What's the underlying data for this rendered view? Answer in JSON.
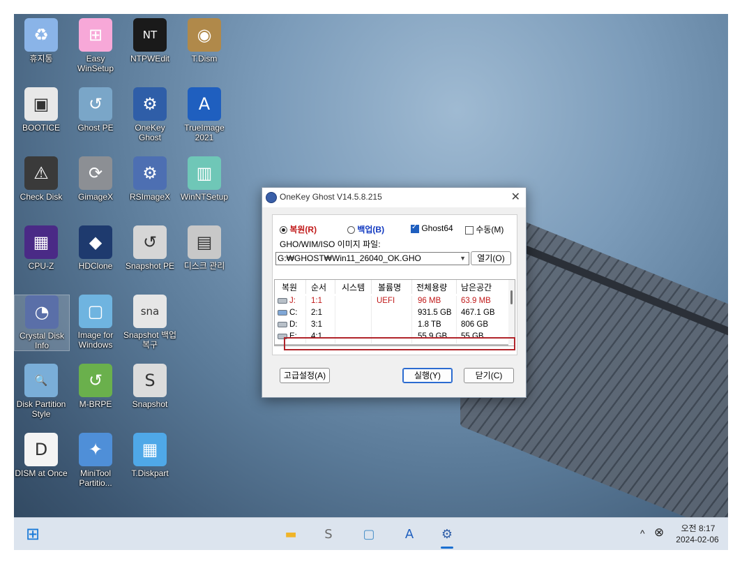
{
  "desktop": {
    "icons": [
      {
        "label": "휴지통",
        "glyph": "♻",
        "color": "#8ab4e8"
      },
      {
        "label": "Easy WinSetup",
        "glyph": "⊞",
        "color": "#f7a8d8"
      },
      {
        "label": "NTPWEdit",
        "glyph": "NT",
        "color": "#1a1a1a"
      },
      {
        "label": "T.Dism",
        "glyph": "◉",
        "color": "#b0894a"
      },
      {
        "label": "BOOTICE",
        "glyph": "▣",
        "color": "#e8e8e8"
      },
      {
        "label": "Ghost PE",
        "glyph": "↺",
        "color": "#7aa6c8"
      },
      {
        "label": "OneKey Ghost",
        "glyph": "⚙",
        "color": "#2f5ea8"
      },
      {
        "label": "TrueImage 2021",
        "glyph": "A",
        "color": "#1f5fbf"
      },
      {
        "label": "Check Disk",
        "glyph": "⚠",
        "color": "#3a3a3a"
      },
      {
        "label": "GimageX",
        "glyph": "⟳",
        "color": "#8c8f94"
      },
      {
        "label": "RSImageX",
        "glyph": "⚙",
        "color": "#4d6fb2"
      },
      {
        "label": "WinNTSetup",
        "glyph": "▥",
        "color": "#6fc7b7"
      },
      {
        "label": "CPU-Z",
        "glyph": "▦",
        "color": "#4a2a86"
      },
      {
        "label": "HDClone",
        "glyph": "◆",
        "color": "#1e3a6e"
      },
      {
        "label": "Snapshot PE",
        "glyph": "↺",
        "color": "#d6d6d6"
      },
      {
        "label": "디스크 관리",
        "glyph": "▤",
        "color": "#c8c8c8"
      },
      {
        "label": "Crystal Disk Info",
        "glyph": "◔",
        "color": "#5a6fa8"
      },
      {
        "label": "Image for Windows",
        "glyph": "▢",
        "color": "#6fb4e0"
      },
      {
        "label": "Snapshot 백업 복구",
        "glyph": "sna",
        "color": "#e6e6e6"
      },
      {
        "label": "Disk Partition Style",
        "glyph": "🔍",
        "color": "#7aaed8"
      },
      {
        "label": "M-BRPE",
        "glyph": "↺",
        "color": "#6ab04c"
      },
      {
        "label": "Snapshot",
        "glyph": "S",
        "color": "#dcdcdc"
      },
      {
        "label": "DISM at Once",
        "glyph": "D",
        "color": "#f4f4f4"
      },
      {
        "label": "MiniTool Partitio...",
        "glyph": "✦",
        "color": "#4f8fd8"
      },
      {
        "label": "T.Diskpart",
        "glyph": "▦",
        "color": "#4fa8e8"
      }
    ]
  },
  "taskbar": {
    "start_glyph": "⊞",
    "apps": [
      {
        "name": "file-explorer",
        "glyph": "▬",
        "color": "#f0b429"
      },
      {
        "name": "snapshot",
        "glyph": "S",
        "color": "#6a6a6a"
      },
      {
        "name": "image-for-windows",
        "glyph": "▢",
        "color": "#4a90c8"
      },
      {
        "name": "trueimage",
        "glyph": "A",
        "color": "#1f5fbf"
      },
      {
        "name": "onekey-ghost",
        "glyph": "⚙",
        "color": "#2f5ea8"
      }
    ],
    "tray": {
      "chevron": "^",
      "close_glyph": "⊗",
      "time": "오전 8:17",
      "date": "2024-02-06"
    }
  },
  "dialog": {
    "title": "OneKey Ghost V14.5.8.215",
    "close_glyph": "✕",
    "restore_label": "복원(R)",
    "backup_label": "백업(B)",
    "ghost64_label": "Ghost64",
    "manual_label": "수동(M)",
    "file_label": "GHO/WIM/ISO 이미지 파일:",
    "file_value": "G:₩GHOST₩Win11_26040_OK.GHO",
    "open_button": "열기(O)",
    "columns": [
      "복원",
      "순서",
      "시스템",
      "볼륨명",
      "전체용량",
      "남은공간"
    ],
    "rows": [
      {
        "drive": "J:",
        "order": "1:1",
        "system": "",
        "volume": "UEFI",
        "total": "96 MB",
        "free": "63.9 MB",
        "red": true
      },
      {
        "drive": "C:",
        "order": "2:1",
        "system": "",
        "volume": "",
        "total": "931.5 GB",
        "free": "467.1 GB",
        "red": false
      },
      {
        "drive": "D:",
        "order": "3:1",
        "system": "",
        "volume": "",
        "total": "1.8 TB",
        "free": "806 GB",
        "red": false
      },
      {
        "drive": "E:",
        "order": "4:1",
        "system": "",
        "volume": "",
        "total": "55.9 GB",
        "free": "55 GB",
        "red": false
      }
    ],
    "advanced_button": "고급설정(A)",
    "run_button": "실행(Y)",
    "close_button": "닫기(C)"
  }
}
